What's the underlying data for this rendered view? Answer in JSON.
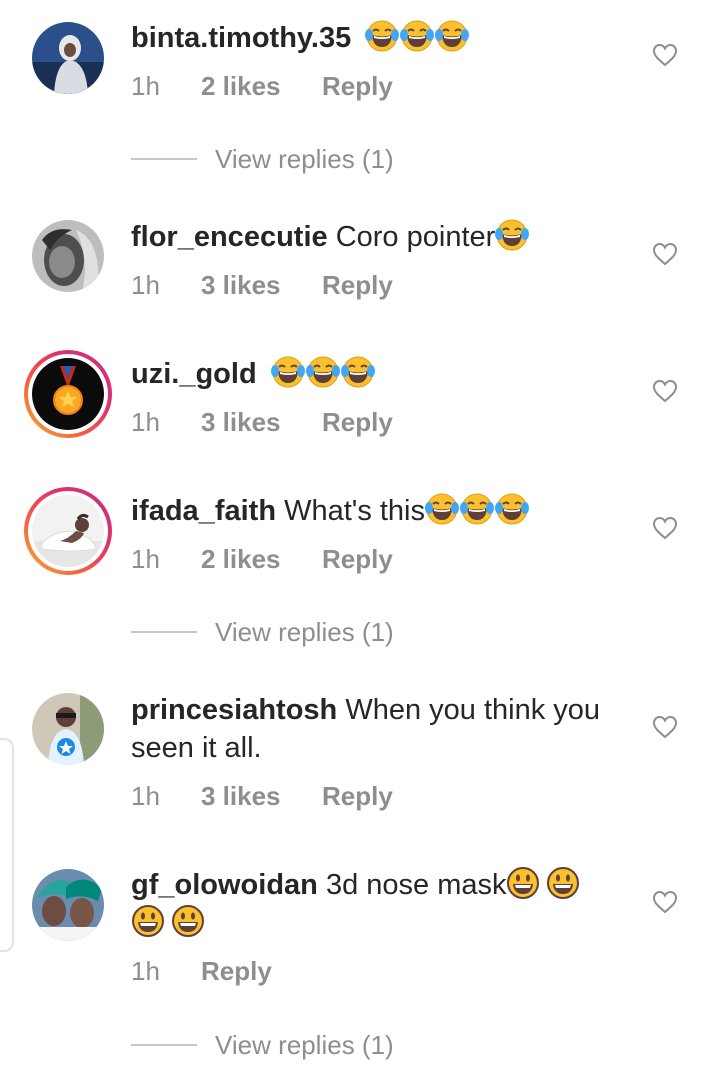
{
  "comments": [
    {
      "username": "binta.timothy.35",
      "text": "",
      "emojis": [
        "laughing-tears-emoji",
        "laughing-tears-emoji",
        "laughing-tears-emoji"
      ],
      "time": "1h",
      "likes": "2 likes",
      "reply": "Reply",
      "view_replies": "View replies (1)"
    },
    {
      "username": "flor_encecutie",
      "text": "Coro pointer",
      "emojis": [
        "laughing-tears-emoji"
      ],
      "time": "1h",
      "likes": "3 likes",
      "reply": "Reply"
    },
    {
      "username": "uzi._gold",
      "text": "",
      "emojis": [
        "laughing-tears-emoji",
        "laughing-tears-emoji",
        "laughing-tears-emoji"
      ],
      "time": "1h",
      "likes": "3 likes",
      "reply": "Reply"
    },
    {
      "username": "ifada_faith",
      "text": "What's this",
      "emojis": [
        "laughing-tears-emoji",
        "laughing-tears-emoji",
        "laughing-tears-emoji"
      ],
      "time": "1h",
      "likes": "2 likes",
      "reply": "Reply",
      "view_replies": "View replies (1)"
    },
    {
      "username": "princesiahtosh",
      "text": "When you think you seen it all.",
      "time": "1h",
      "likes": "3 likes",
      "reply": "Reply"
    },
    {
      "username": "gf_olowoidan",
      "text": "3d nose mask",
      "emojis": [
        "grinning-emoji",
        "grinning-emoji",
        "grinning-emoji",
        "grinning-emoji"
      ],
      "time": "1h",
      "reply": "Reply",
      "view_replies": "View replies (1)"
    }
  ],
  "icons": {
    "like": "heart-outline-icon",
    "laugh": "laughing-tears-emoji",
    "grin": "grinning-emoji"
  },
  "colors": {
    "text": "#262626",
    "meta": "#8e8e8e",
    "divider": "#c7c7c7",
    "story_ring_start": "#f9b233",
    "story_ring_end": "#c13584",
    "emoji_yellow": "#fbc02d",
    "emoji_tear": "#42a5f5"
  }
}
